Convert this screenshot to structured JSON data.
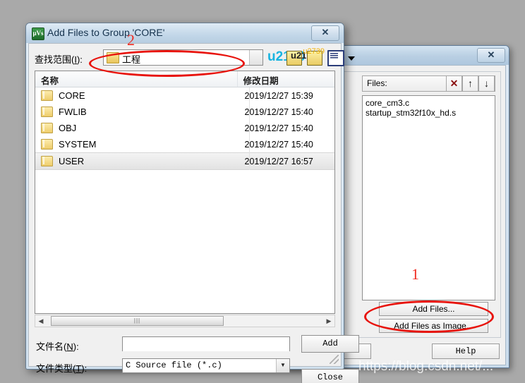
{
  "background_window": {
    "close_label": "✕",
    "files_panel": {
      "header_label": "Files:",
      "buttons": [
        {
          "name": "remove",
          "glyph": "✕"
        },
        {
          "name": "move-up",
          "glyph": "↑"
        },
        {
          "name": "move-down",
          "glyph": "↓"
        }
      ],
      "items": [
        "core_cm3.c",
        "startup_stm32f10x_hd.s"
      ],
      "add_files_label": "Add Files...",
      "add_files_as_image_label": "Add Files as Image..."
    },
    "tree_down_button_glyph": "↓",
    "bottom_buttons": [
      {
        "name": "button-1",
        "label": ""
      },
      {
        "name": "button-2",
        "label": ""
      },
      {
        "name": "help",
        "label": "Help"
      }
    ]
  },
  "dialog": {
    "title": "Add Files to Group 'CORE'",
    "icon_text": "μVs",
    "close_label": "✕",
    "lookin": {
      "label_prefix": "查找范围(",
      "label_accel": "I",
      "label_suffix": "):",
      "value": "工程",
      "dropdown_glyph": "▼"
    },
    "toolbar": [
      {
        "name": "back",
        "glyph": "←"
      },
      {
        "name": "up-one-level",
        "glyph": "↑"
      },
      {
        "name": "new-folder",
        "glyph": "✸"
      },
      {
        "name": "views",
        "glyph": "▼"
      }
    ],
    "filelist": {
      "columns": [
        "名称",
        "修改日期"
      ],
      "rows": [
        {
          "name": "CORE",
          "date": "2019/12/27 15:39",
          "selected": false
        },
        {
          "name": "FWLIB",
          "date": "2019/12/27 15:40",
          "selected": false
        },
        {
          "name": "OBJ",
          "date": "2019/12/27 15:40",
          "selected": false
        },
        {
          "name": "SYSTEM",
          "date": "2019/12/27 15:40",
          "selected": false
        },
        {
          "name": "USER",
          "date": "2019/12/27 16:57",
          "selected": true
        }
      ]
    },
    "hscroll": {
      "left_glyph": "◀",
      "right_glyph": "▶",
      "thumb_grip": "|||"
    },
    "filename": {
      "label_prefix": "文件名(",
      "label_accel": "N",
      "label_suffix": "):",
      "value": "",
      "placeholder": ""
    },
    "filetype": {
      "label_prefix": "文件类型(",
      "label_accel": "T",
      "label_suffix": "):",
      "value": "C Source file (*.c)",
      "dropdown_glyph": "▼"
    },
    "buttons": {
      "add_label": "Add",
      "close_label": "Close"
    }
  },
  "annotations": {
    "number_1": "1",
    "number_2": "2",
    "color": "#e8140d"
  },
  "watermark": {
    "text": "https://blog.csdn.net/..."
  }
}
